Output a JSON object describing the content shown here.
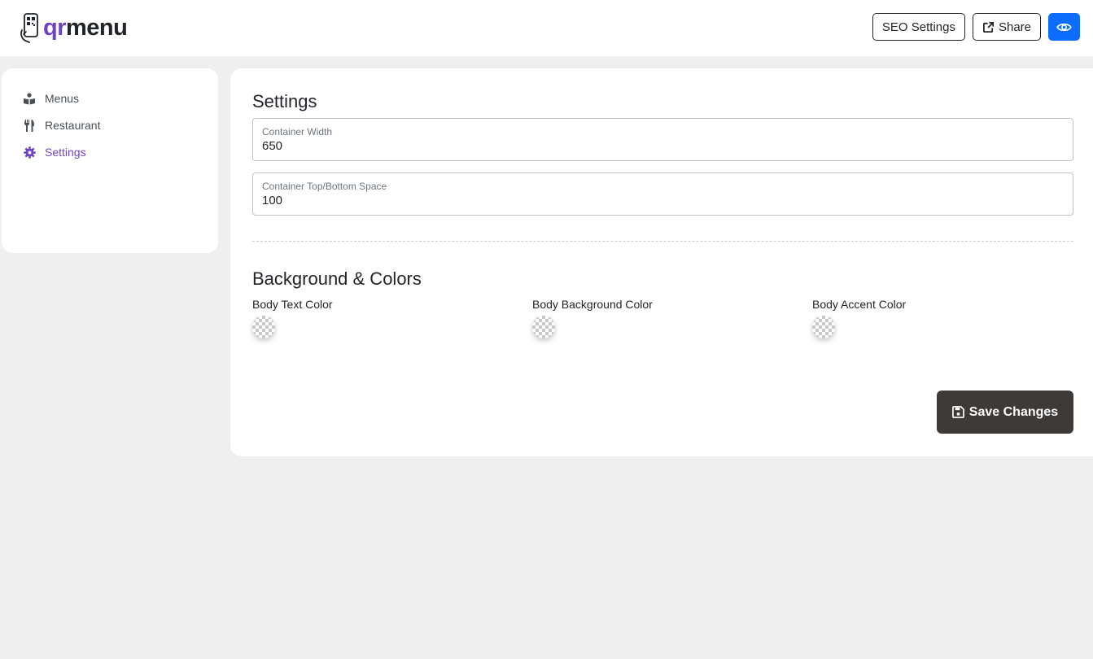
{
  "brand": {
    "name_accent": "qr",
    "name_rest": "menu"
  },
  "header": {
    "seo_label": "SEO Settings",
    "share_label": "Share",
    "preview_icon": "eye-icon"
  },
  "sidebar": {
    "items": [
      {
        "label": "Menus",
        "icon": "menu-book-icon",
        "active": false
      },
      {
        "label": "Restaurant",
        "icon": "utensils-icon",
        "active": false
      },
      {
        "label": "Settings",
        "icon": "gear-icon",
        "active": true
      }
    ]
  },
  "settings": {
    "title": "Settings",
    "container_width": {
      "label": "Container Width",
      "value": "650"
    },
    "container_space": {
      "label": "Container Top/Bottom Space",
      "value": "100"
    }
  },
  "colors": {
    "title": "Background & Colors",
    "items": [
      {
        "label": "Body Text Color"
      },
      {
        "label": "Body Background Color"
      },
      {
        "label": "Body Accent Color"
      }
    ]
  },
  "save_label": "Save Changes",
  "theme": {
    "accent": "#6f42c1",
    "primary": "#0d6efd",
    "save_bg": "#3d3a38",
    "page_bg": "#efeff0"
  }
}
